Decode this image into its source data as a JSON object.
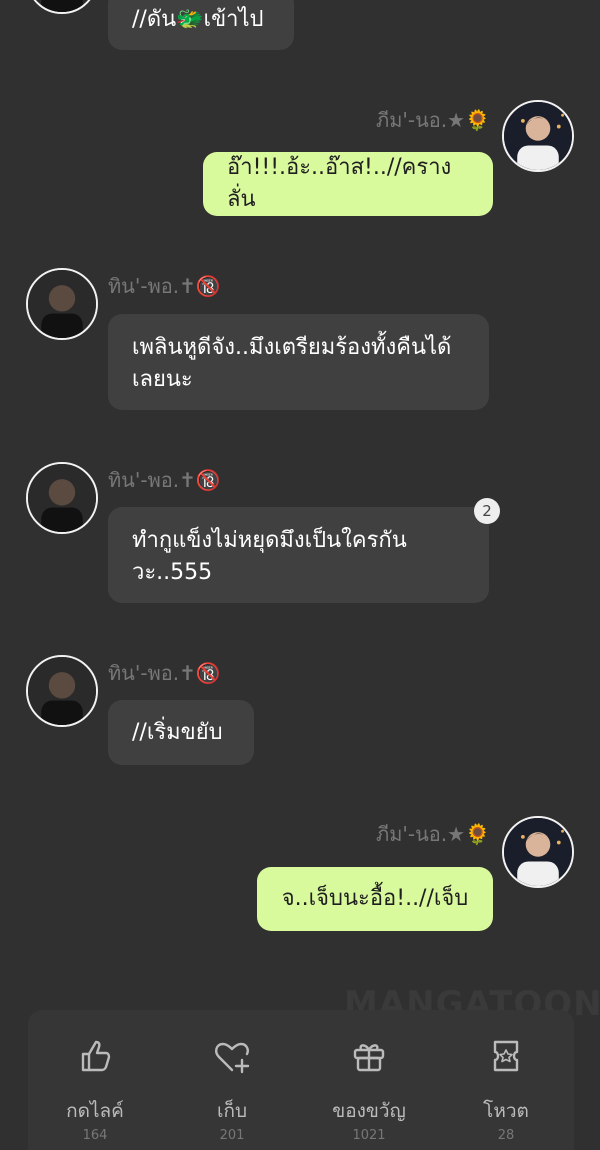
{
  "messages": [
    {
      "text": "//ดัน🐲เข้าไป"
    },
    {
      "sender": "ภีม'-นอ.★🌻",
      "text": "อ๊า!!!.อ้ะ..อ๊าส!..//ครางลั่น"
    },
    {
      "sender": "ทิน'-พอ.✝🔞",
      "text": "เพลินหูดีจัง..มึงเตรียมร้องทั้งคืนได้เลยนะ"
    },
    {
      "sender": "ทิน'-พอ.✝🔞",
      "text": "ทำกูแข็งไม่หยุดมึงเป็นใครกันวะ..555",
      "comment_count": "2"
    },
    {
      "sender": "ทิน'-พอ.✝🔞",
      "text": "//เริ่มขยับ"
    },
    {
      "sender": "ภีม'-นอ.★🌻",
      "text": "จ..เจ็บนะอื้อ!..//เจ็บ"
    }
  ],
  "watermark": "MANGATOON",
  "actions": [
    {
      "icon": "thumbs-up-icon",
      "label": "กดไลค์",
      "count": "164"
    },
    {
      "icon": "heart-plus-icon",
      "label": "เก็บ",
      "count": "201"
    },
    {
      "icon": "gift-icon",
      "label": "ของขวัญ",
      "count": "1021"
    },
    {
      "icon": "vote-ticket-icon",
      "label": "โหวต",
      "count": "28"
    }
  ],
  "colors": {
    "background": "#303030",
    "bubble_left": "#404040",
    "bubble_right": "#d9f99d",
    "name_text": "#777777"
  }
}
